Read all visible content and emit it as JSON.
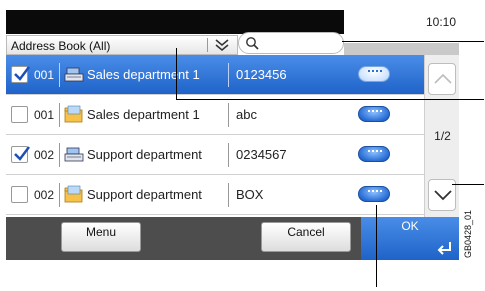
{
  "status_bar": {
    "time": "10:10"
  },
  "header": {
    "address_book_label": "Address Book (All)",
    "search_placeholder": ""
  },
  "rows": [
    {
      "checked": true,
      "number": "001",
      "icon": "scanner-icon",
      "name": "Sales department 1",
      "value": "0123456",
      "selected": true
    },
    {
      "checked": false,
      "number": "001",
      "icon": "folder-icon",
      "name": "Sales department 1",
      "value": "abc",
      "selected": false
    },
    {
      "checked": true,
      "number": "002",
      "icon": "scanner-icon",
      "name": "Support department",
      "value": "0234567",
      "selected": false
    },
    {
      "checked": false,
      "number": "002",
      "icon": "folder-icon",
      "name": "Support department",
      "value": "BOX",
      "selected": false
    }
  ],
  "pagination": {
    "label": "1/2"
  },
  "footer": {
    "menu_label": "Menu",
    "cancel_label": "Cancel",
    "ok_label": "OK"
  },
  "figure_code": "GB0428_01",
  "colors": {
    "accent": "#1f63c9",
    "footer": "#4d4d4d",
    "status_bar": "#0a0a0a"
  }
}
